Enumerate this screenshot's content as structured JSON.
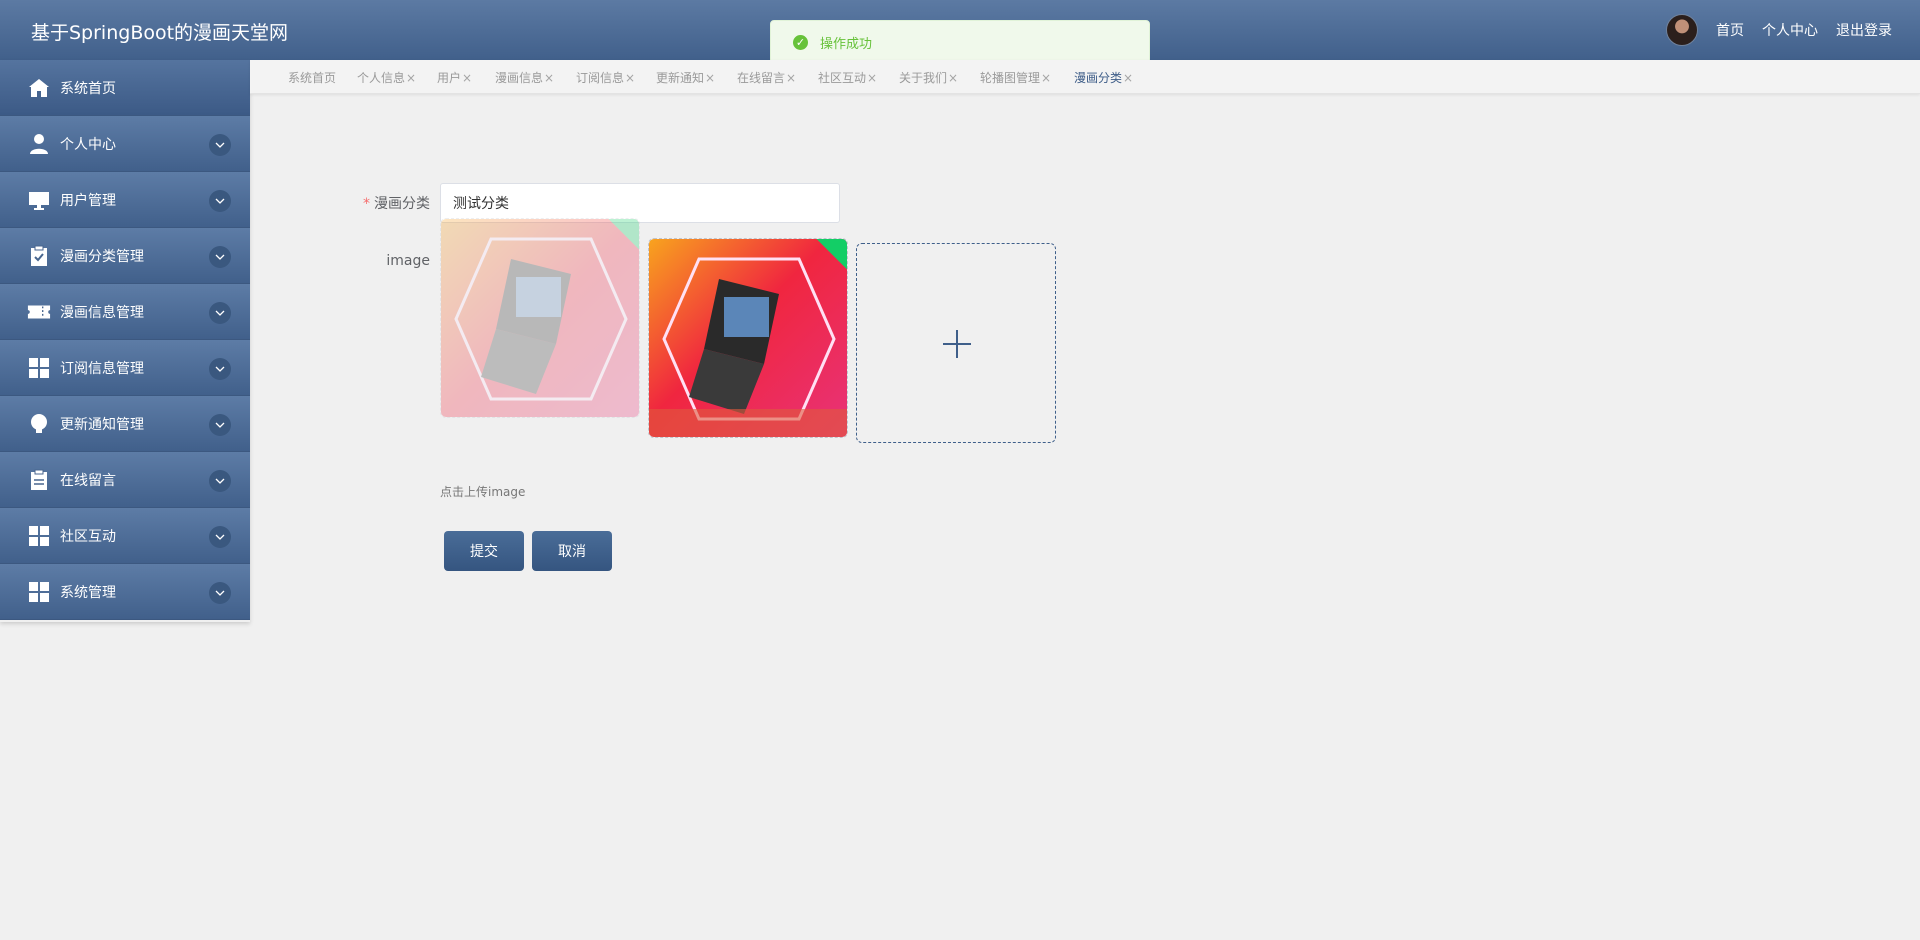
{
  "header": {
    "title": "基于SpringBoot的漫画天堂网",
    "links": [
      "首页",
      "个人中心",
      "退出登录"
    ]
  },
  "toast": {
    "text": "操作成功",
    "icon": "success-check-icon",
    "color": "#67c23a"
  },
  "sidebar": {
    "items": [
      {
        "label": "系统首页",
        "icon": "home-icon"
      },
      {
        "label": "个人中心",
        "icon": "user-icon"
      },
      {
        "label": "用户管理",
        "icon": "monitor-icon"
      },
      {
        "label": "漫画分类管理",
        "icon": "clipboard-check-icon"
      },
      {
        "label": "漫画信息管理",
        "icon": "ticket-icon"
      },
      {
        "label": "订阅信息管理",
        "icon": "grid-icon"
      },
      {
        "label": "更新通知管理",
        "icon": "bulb-icon"
      },
      {
        "label": "在线留言",
        "icon": "notepad-icon"
      },
      {
        "label": "社区互动",
        "icon": "grid-icon"
      },
      {
        "label": "系统管理",
        "icon": "grid-icon"
      }
    ]
  },
  "tabs": [
    {
      "label": "系统首页",
      "closable": false
    },
    {
      "label": "个人信息",
      "closable": true
    },
    {
      "label": "用户",
      "closable": true
    },
    {
      "label": "漫画信息",
      "closable": true
    },
    {
      "label": "订阅信息",
      "closable": true
    },
    {
      "label": "更新通知",
      "closable": true
    },
    {
      "label": "在线留言",
      "closable": true
    },
    {
      "label": "社区互动",
      "closable": true
    },
    {
      "label": "关于我们",
      "closable": true
    },
    {
      "label": "轮播图管理",
      "closable": true
    },
    {
      "label": "漫画分类",
      "closable": true,
      "active": true
    }
  ],
  "form": {
    "category_label": "漫画分类",
    "category_value": "测试分类",
    "image_label": "image",
    "upload_tip": "点击上传image",
    "submit_label": "提交",
    "cancel_label": "取消"
  },
  "colors": {
    "brand": "#41608b",
    "success": "#67c23a",
    "required": "#f56c6c"
  }
}
